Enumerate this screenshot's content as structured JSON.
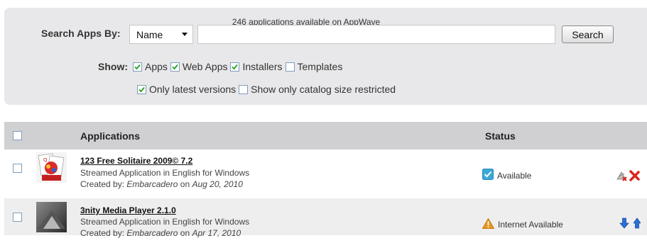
{
  "header": {
    "available_text": "246 applications available on AppWave"
  },
  "search": {
    "label": "Search Apps By:",
    "field_selected": "Name",
    "query_value": "",
    "button_label": "Search"
  },
  "filters": {
    "show_label": "Show:",
    "options": [
      {
        "label": "Apps",
        "checked": true
      },
      {
        "label": "Web Apps",
        "checked": true
      },
      {
        "label": "Installers",
        "checked": true
      },
      {
        "label": "Templates",
        "checked": false
      }
    ],
    "options2": [
      {
        "label": "Only latest versions",
        "checked": true
      },
      {
        "label": "Show only catalog size restricted",
        "checked": false
      }
    ]
  },
  "table": {
    "columns": {
      "applications": "Applications",
      "status": "Status"
    },
    "rows": [
      {
        "title": "123 Free Solitaire 2009© 7.2",
        "subtitle": "Streamed Application in English for Windows",
        "created_prefix": "Created by:",
        "creator": "Embarcadero",
        "on": "on",
        "date": "Aug 20, 2010",
        "status": "Available",
        "status_icon": "check-icon",
        "status_color": "#3aa8d8"
      },
      {
        "title": "3nity Media Player 2.1.0",
        "subtitle": "Streamed Application in English for Windows",
        "created_prefix": "Created by:",
        "creator": "Embarcadero",
        "on": "on",
        "date": "Apr 17, 2010",
        "status": "Internet Available",
        "status_icon": "warning-icon",
        "status_color": "#e8961e"
      }
    ]
  },
  "colors": {
    "panel_bg": "#e8e8ea",
    "header_bg": "#d0d0d2",
    "row_alt_bg": "#eeeeef",
    "remove_red": "#d9261c",
    "arrow_blue": "#2a6fd6"
  }
}
